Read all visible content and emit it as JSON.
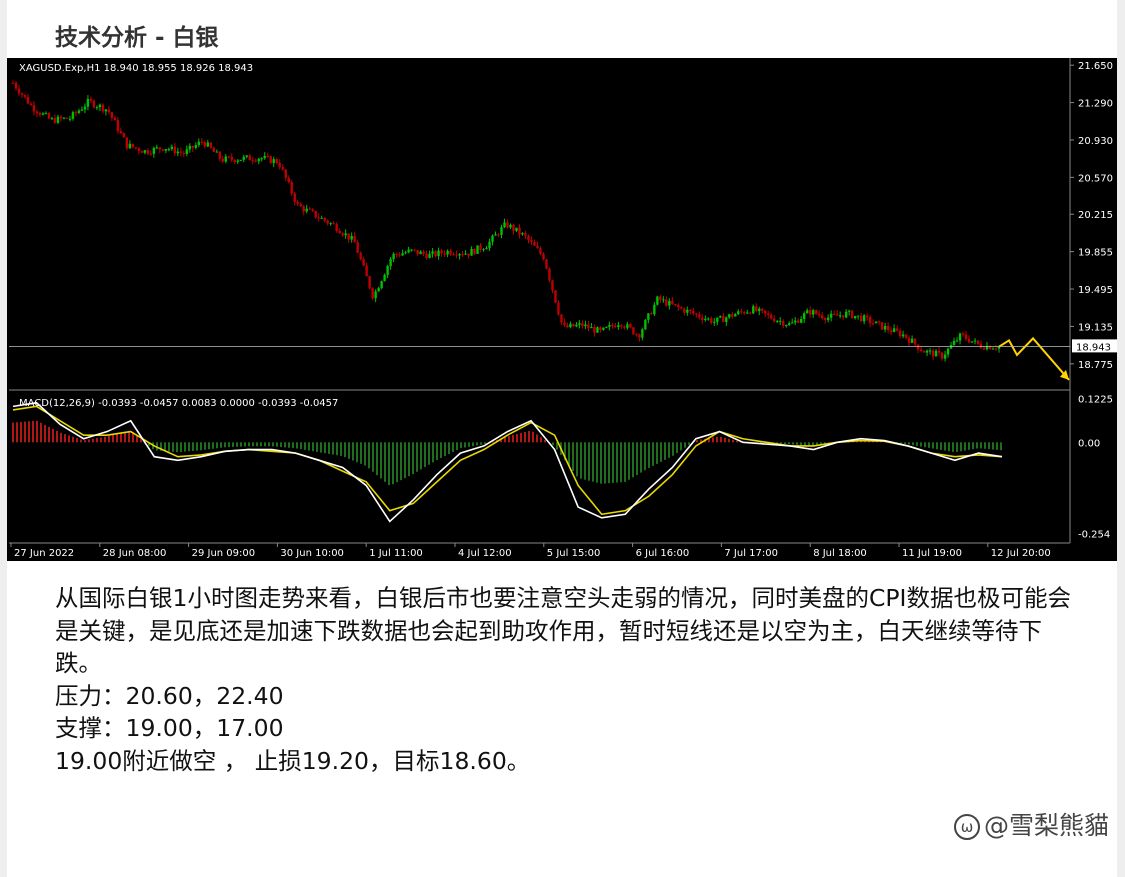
{
  "header": {
    "title": "技术分析 - 白银"
  },
  "chart_data": [
    {
      "type": "candlestick",
      "title": "XAGUSD.Exp,H1  18.940 18.955 18.926 18.943",
      "symbol": "XAGUSD.Exp",
      "timeframe": "H1",
      "ohlc_last": {
        "open": 18.94,
        "high": 18.955,
        "low": 18.926,
        "close": 18.943
      },
      "ylim": [
        18.6,
        21.7
      ],
      "yticks": [
        "21.650",
        "21.290",
        "20.930",
        "20.570",
        "20.215",
        "19.855",
        "19.495",
        "19.135",
        "18.775"
      ],
      "current_price_label": "18.943",
      "xticks": [
        "27 Jun 2022",
        "28 Jun 08:00",
        "29 Jun 09:00",
        "30 Jun 10:00",
        "1 Jul 11:00",
        "4 Jul 12:00",
        "5 Jul 15:00",
        "6 Jul 16:00",
        "7 Jul 17:00",
        "8 Jul 18:00",
        "11 Jul 19:00",
        "12 Jul 20:00"
      ],
      "close_path": [
        21.48,
        21.25,
        21.12,
        21.14,
        21.3,
        21.22,
        20.88,
        20.82,
        20.86,
        20.8,
        20.92,
        20.74,
        20.75,
        20.76,
        20.72,
        20.3,
        20.2,
        20.1,
        19.95,
        19.42,
        19.82,
        19.86,
        19.82,
        19.86,
        19.84,
        19.92,
        20.12,
        20.0,
        19.8,
        19.12,
        19.15,
        19.08,
        19.18,
        19.05,
        19.4,
        19.32,
        19.25,
        19.18,
        19.25,
        19.3,
        19.22,
        19.15,
        19.28,
        19.22,
        19.26,
        19.2,
        19.12,
        19.05,
        18.9,
        18.85,
        19.05,
        18.95,
        18.94
      ],
      "forecast_path": [
        18.94,
        19.0,
        18.86,
        19.02,
        18.62
      ],
      "colors": {
        "up": "#00c000",
        "down": "#c00000",
        "forecast": "#ffd400",
        "price_line": "#c0c0c0"
      }
    },
    {
      "type": "macd",
      "title": "MACD(12,26,9) -0.0393 -0.0457 0.0083 0.0000 -0.0393 -0.0457",
      "ylim": [
        -0.28,
        0.14
      ],
      "yticks": [
        "0.1225",
        "0.00",
        "-0.254"
      ],
      "macd_line": [
        0.1,
        0.11,
        0.05,
        0.01,
        0.03,
        0.06,
        -0.04,
        -0.05,
        -0.04,
        -0.025,
        -0.02,
        -0.02,
        -0.03,
        -0.05,
        -0.07,
        -0.12,
        -0.22,
        -0.16,
        -0.09,
        -0.03,
        -0.01,
        0.03,
        0.06,
        -0.02,
        -0.18,
        -0.21,
        -0.2,
        -0.13,
        -0.07,
        0.01,
        0.03,
        0.0,
        -0.005,
        -0.01,
        -0.02,
        0.0,
        0.01,
        0.005,
        -0.01,
        -0.03,
        -0.05,
        -0.03,
        -0.04
      ],
      "signal_line": [
        0.09,
        0.1,
        0.06,
        0.02,
        0.02,
        0.03,
        -0.01,
        -0.04,
        -0.035,
        -0.025,
        -0.02,
        -0.025,
        -0.03,
        -0.05,
        -0.08,
        -0.11,
        -0.19,
        -0.17,
        -0.11,
        -0.05,
        -0.02,
        0.02,
        0.055,
        0.02,
        -0.12,
        -0.2,
        -0.19,
        -0.15,
        -0.09,
        -0.01,
        0.03,
        0.01,
        0.0,
        -0.01,
        -0.01,
        0.0,
        0.005,
        0.003,
        -0.01,
        -0.03,
        -0.04,
        -0.035,
        -0.04
      ],
      "colors": {
        "macd": "#ffffff",
        "signal": "#e6d800",
        "hist_up": "#b01818",
        "hist_down": "#1e6e1e"
      }
    }
  ],
  "content": {
    "paragraph": "从国际白银1小时图走势来看，白银后市也要注意空头走弱的情况，同时美盘的CPI数据也极可能会是关键，是见底还是加速下跌数据也会起到助攻作用，暂时短线还是以空为主，白天继续等待下跌。",
    "resistance": "压力：20.60，22.40",
    "support": "支撑：19.00，17.00",
    "trade": "19.00附近做空 ， 止损19.20，目标18.60。"
  },
  "watermark": {
    "text": "@雪梨熊貓",
    "icon": "weibo-logo-icon"
  }
}
